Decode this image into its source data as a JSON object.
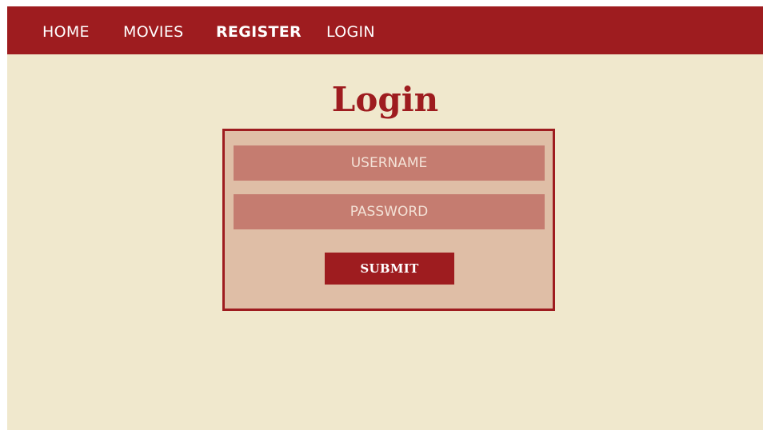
{
  "nav": {
    "items": [
      {
        "label": "HOME"
      },
      {
        "label": "MOVIES"
      },
      {
        "label": "REGISTER"
      },
      {
        "label": "LOGIN"
      }
    ],
    "active_item": "REGISTER"
  },
  "main": {
    "title": "Login"
  },
  "form": {
    "username_placeholder": "USERNAME",
    "password_placeholder": "PASSWORD",
    "submit_label": "SUBMIT"
  },
  "colors": {
    "brand_red": "#9e1c1f",
    "background_cream": "#f0e8cd",
    "form_panel": "#dfbea6",
    "input_fill": "#c57c70",
    "placeholder_text": "#f3e1d6"
  }
}
